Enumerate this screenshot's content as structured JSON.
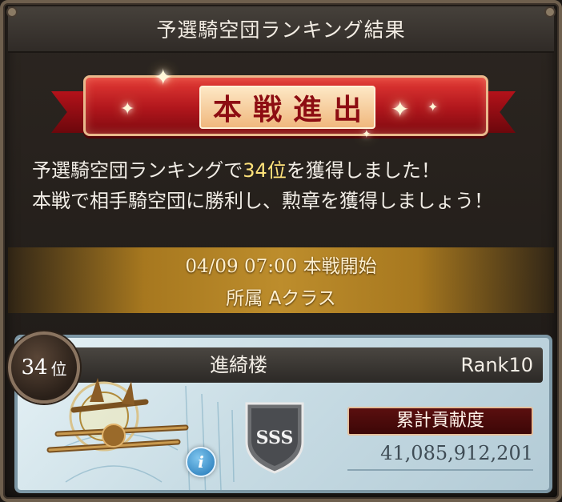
{
  "window": {
    "title": "予選騎空団ランキング結果"
  },
  "banner": {
    "text": "本戦進出"
  },
  "message": {
    "line1_prefix": "予選騎空団ランキングで",
    "line1_rank": "34位",
    "line1_suffix": "を獲得しました！",
    "line2": "本戦で相手騎空団に勝利し、勲章を獲得しましょう！"
  },
  "schedule": {
    "start": "04/09 07:00 本戦開始",
    "class": "所属 Aクラス"
  },
  "crew_card": {
    "rank_number": "34",
    "rank_unit": "位",
    "name": "進綺楼",
    "crew_rank": "Rank10",
    "grade": "SSS",
    "info_label": "i",
    "contribution_label": "累計貢献度",
    "contribution_value": "41,085,912,201"
  },
  "colors": {
    "highlight": "#ffe27a",
    "ribbon_red": "#b0161c",
    "gold_band": "#bd8d2c",
    "card_bg": "#c9dde5"
  },
  "icons": [
    "sparkle-icon",
    "info-icon",
    "sss-grade-icon",
    "crew-emblem-icon"
  ]
}
